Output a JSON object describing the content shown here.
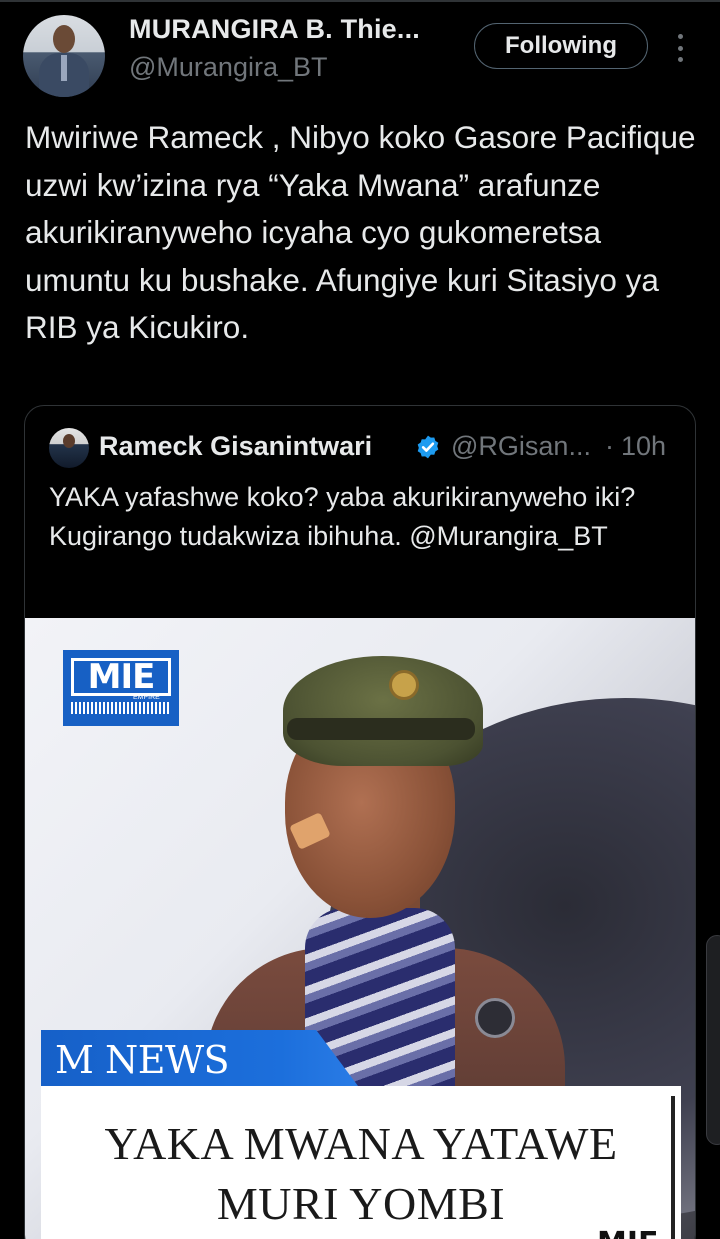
{
  "tweet": {
    "author": {
      "name": "MURANGIRA B. Thie...",
      "handle": "@Murangira_BT",
      "avatar_icon": "profile-photo"
    },
    "follow_label": "Following",
    "more_icon": "more-vertical-icon",
    "text": "Mwiriwe Rameck , Nibyo koko Gasore Pacifique uzwi kw’izina rya “Yaka Mwana” arafunze akurikiranyweho icyaha cyo gukomeretsa umuntu ku bushake. Afungiye kuri Sitasiyo ya RIB ya Kicukiro."
  },
  "quoted_tweet": {
    "author": {
      "name": "Rameck Gisanintwari",
      "verified": true,
      "handle": "@RGisan...",
      "separator": "·",
      "time": "10h"
    },
    "text": "YAKA yafashwe koko? yaba akurikiranyweho iki? Kugirango tudakwiza ibihuha. @Murangira_BT",
    "media": {
      "logo_text": "MIE",
      "logo_sub": "EMPIRE",
      "banner_label": "M NEWS",
      "headline_line1": "YAKA MWANA YATAWE",
      "headline_line2": "MURI YOMBI",
      "corner_mark": "MIE"
    }
  },
  "colors": {
    "background": "#000000",
    "text_primary": "#e7e9ea",
    "text_secondary": "#71767b",
    "border": "#2f3336",
    "verified_blue": "#1d9bf0",
    "news_blue": "#1660c8"
  }
}
